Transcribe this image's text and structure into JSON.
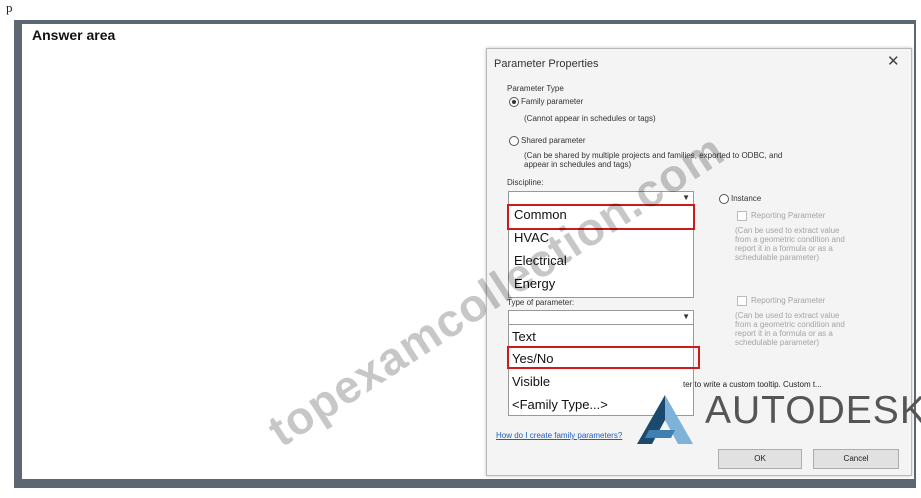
{
  "top_text": "p",
  "answer_area": {
    "title": "Answer area"
  },
  "dialog": {
    "title": "Parameter Properties",
    "parameter_type_label": "Parameter Type",
    "family_parameter_label": "Family parameter",
    "family_parameter_note": "(Cannot appear in schedules or tags)",
    "shared_parameter_label": "Shared parameter",
    "shared_parameter_note_1": "(Can be shared by multiple projects and families, exported to ODBC, and",
    "shared_parameter_note_2": "appear in schedules and tags)",
    "discipline_label": "Discipline:",
    "discipline_options": [
      "Common",
      "HVAC",
      "Electrical",
      "Energy"
    ],
    "instance_label": "Instance",
    "reporting_parameter_label": "Reporting Parameter",
    "reporting_note_1": "(Can be used to extract value",
    "reporting_note_2": "from a geometric condition and",
    "reporting_note_3": "report it in a formula or as a",
    "reporting_note_4": "schedulable parameter)",
    "type_of_parameter_label": "Type of parameter:",
    "type_options": [
      "Text",
      "Yes/No",
      "Visible",
      "<Family Type...>"
    ],
    "tooltip_text": "ter to write a custom tooltip. Custom t...",
    "help_link": "How do I create family parameters?",
    "ok_label": "OK",
    "cancel_label": "Cancel"
  },
  "brand": "AUTODESK",
  "watermark": "topexamcollection.com",
  "colors": {
    "frame": "#5d6771",
    "highlight": "#cc1b1b",
    "link": "#1f5fbf",
    "logo_dark": "#1b4a6e",
    "logo_light": "#7fb2d8"
  }
}
